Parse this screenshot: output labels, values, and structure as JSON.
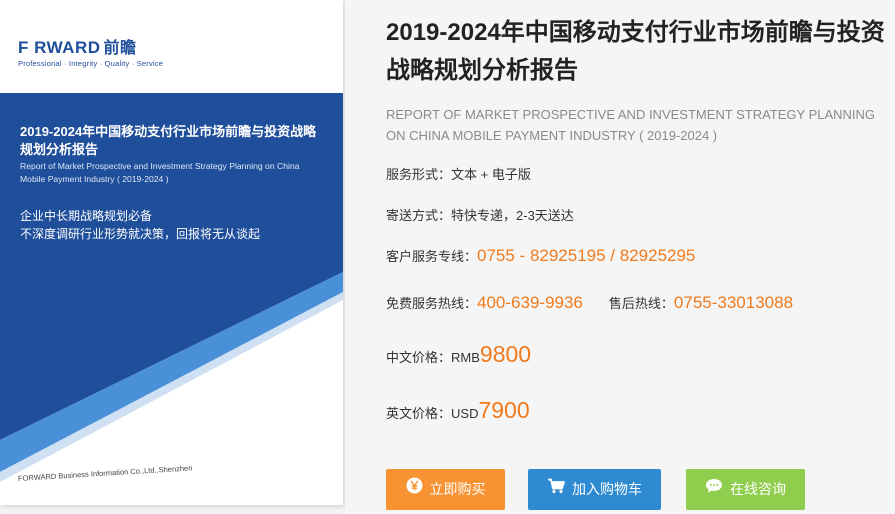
{
  "cover": {
    "logo_text": "F RWARD",
    "logo_cn": "前瞻",
    "logo_tagline": "Professional · Integrity · Quality · Service",
    "title": "2019-2024年中国移动支付行业市场前瞻与投资战略规划分析报告",
    "title_en": "Report of Market Prospective and Investment Strategy Planning on China Mobile Payment Industry ( 2019-2024 )",
    "tagline_1": "企业中长期战略规划必备",
    "tagline_2": "不深度调研行业形势就决策，回报将无从谈起",
    "company": "FORWARD Business Information Co.,Ltd.,Shenzhen",
    "colors": {
      "blue": "#1f4e9a",
      "light_blue": "#4a90d9"
    }
  },
  "product": {
    "title": "2019-2024年中国移动支付行业市场前瞻与投资战略规划分析报告",
    "subtitle": "REPORT OF MARKET PROSPECTIVE AND INVESTMENT STRATEGY PLANNING ON CHINA MOBILE PAYMENT INDUSTRY ( 2019-2024 )",
    "service_form_label": "服务形式：",
    "service_form_value": "文本 + 电子版",
    "delivery_label": "寄送方式：",
    "delivery_value": "特快专递，2-3天送达",
    "hotline_label": "客户服务专线：",
    "hotline_value": "0755 - 82925195 / 82925295",
    "free_hotline_label": "免费服务热线：",
    "free_hotline_value": "400-639-9936",
    "after_sales_label": "售后热线：",
    "after_sales_value": "0755-33013088",
    "cn_price_label": "中文价格：",
    "cn_price_currency": "RMB",
    "cn_price_value": "9800",
    "en_price_label": "英文价格：",
    "en_price_currency": "USD",
    "en_price_value": "7900"
  },
  "buttons": {
    "buy_label": "立即购买",
    "cart_label": "加入购物车",
    "chat_label": "在线咨询",
    "buy_icon": "yen-icon",
    "cart_icon": "cart-icon",
    "chat_icon": "chat-bubble-icon",
    "colors": {
      "buy": "#f79332",
      "cart": "#2e8bd1",
      "chat": "#8fcd4c"
    }
  },
  "colors": {
    "accent": "#f07a1c"
  }
}
